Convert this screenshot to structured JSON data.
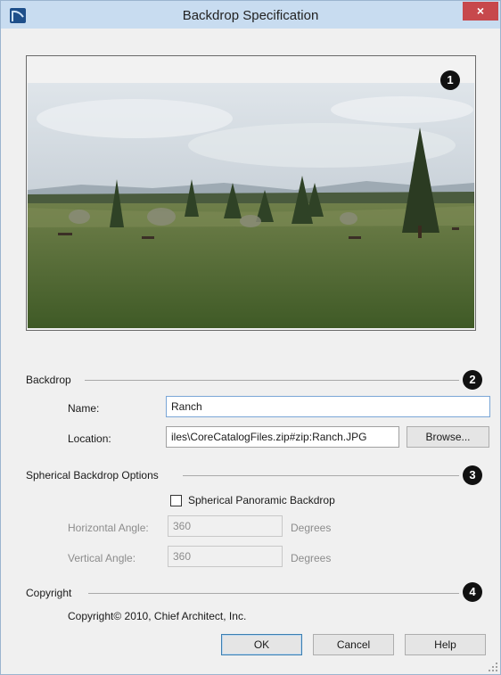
{
  "window": {
    "title": "Backdrop Specification",
    "close_glyph": "×"
  },
  "callouts": [
    "1",
    "2",
    "3",
    "4"
  ],
  "preview": {
    "image_icon": "panorama-photo"
  },
  "backdrop": {
    "group_label": "Backdrop",
    "name_label": "Name:",
    "name_value": "Ranch",
    "location_label": "Location:",
    "location_value": "iles\\CoreCatalogFiles.zip#zip:Ranch.JPG",
    "browse_label": "Browse..."
  },
  "spherical": {
    "group_label": "Spherical Backdrop Options",
    "checkbox_label": "Spherical Panoramic Backdrop",
    "checked": false,
    "horizontal_label": "Horizontal Angle:",
    "horizontal_value": "360",
    "horizontal_unit": "Degrees",
    "vertical_label": "Vertical Angle:",
    "vertical_value": "360",
    "vertical_unit": "Degrees"
  },
  "copyright": {
    "group_label": "Copyright",
    "text": "Copyright© 2010, Chief Architect, Inc."
  },
  "buttons": {
    "ok": "OK",
    "cancel": "Cancel",
    "help": "Help"
  },
  "colors": {
    "titlebar": "#c8dcf0",
    "close": "#c7484c",
    "accent_border": "#7aa6d6"
  }
}
